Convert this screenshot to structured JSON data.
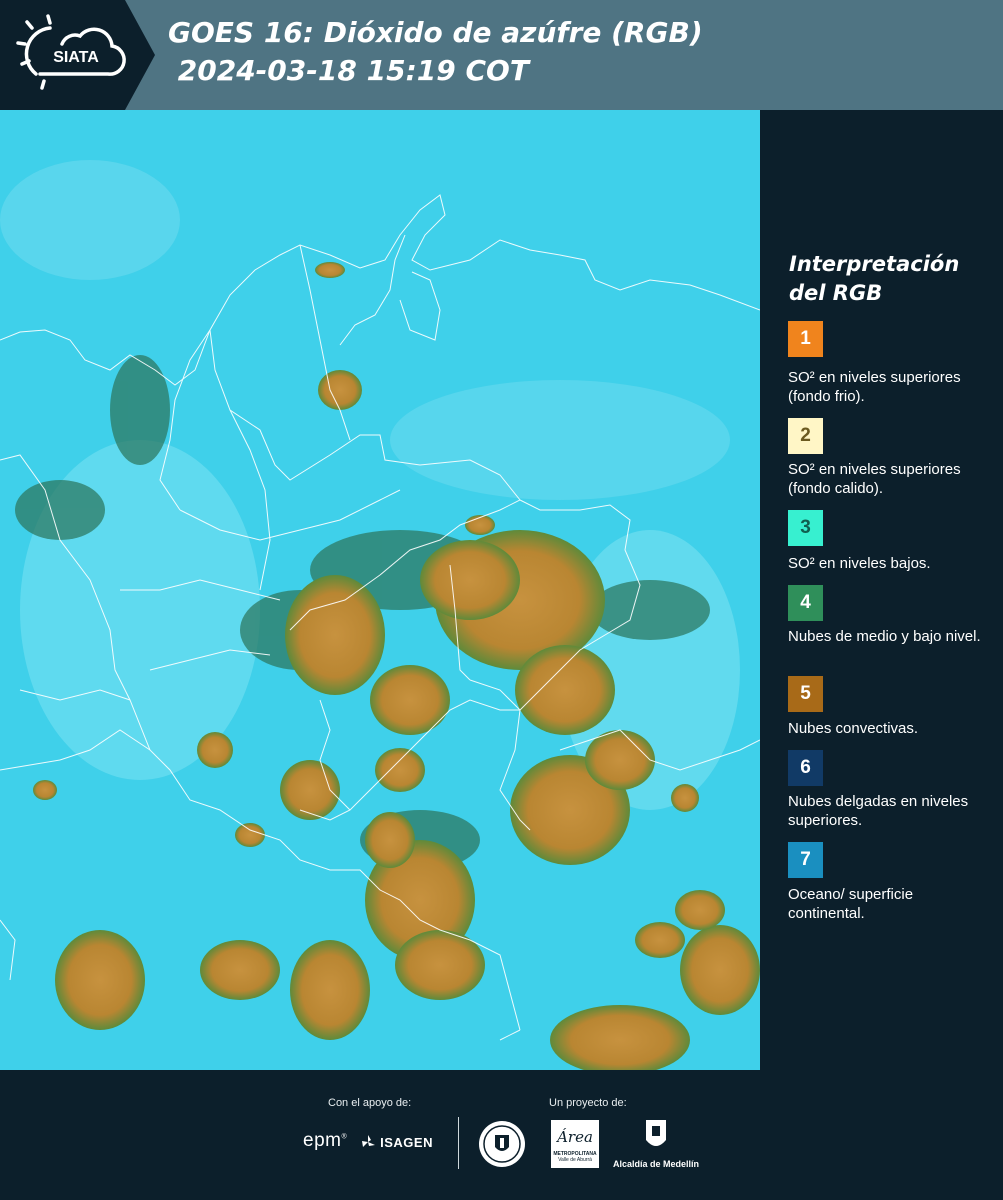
{
  "header": {
    "logo_text": "SIATA",
    "title": "GOES 16: Dióxido de azúfre (RGB)\n 2024-03-18 15:19 COT"
  },
  "legend": {
    "title": "Interpretación del RGB",
    "items": [
      {
        "num": "1",
        "color": "#f0841d",
        "text": "SO² en niveles superiores (fondo frio)."
      },
      {
        "num": "2",
        "color": "#fff6c6",
        "text": "SO² en niveles superiores (fondo calido)."
      },
      {
        "num": "3",
        "color": "#37f0d0",
        "text": "SO² en niveles bajos."
      },
      {
        "num": "4",
        "color": "#2f8f5a",
        "text": "Nubes de medio y bajo nivel."
      },
      {
        "num": "5",
        "color": "#a86a18",
        "text": "Nubes convectivas."
      },
      {
        "num": "6",
        "color": "#113a66",
        "text": "Nubes delgadas en niveles superiores."
      },
      {
        "num": "7",
        "color": "#1a8fc0",
        "text": "Oceano/ superficie continental."
      }
    ]
  },
  "footer": {
    "support_label": "Con el apoyo de:",
    "project_label": "Un proyecto de:",
    "epm": "epm",
    "isagen": "ISAGEN",
    "area_top": "Área",
    "area_sub": "METROPOLITANA",
    "area_sub2": "Valle de Aburrá",
    "alcaldia": "Alcaldía de Medellín"
  },
  "colors": {
    "header_bg": "#4f7483",
    "dark_bg": "#0c1f2b",
    "ocean": "#3fd0ea",
    "cloud": "#c28a3a"
  }
}
